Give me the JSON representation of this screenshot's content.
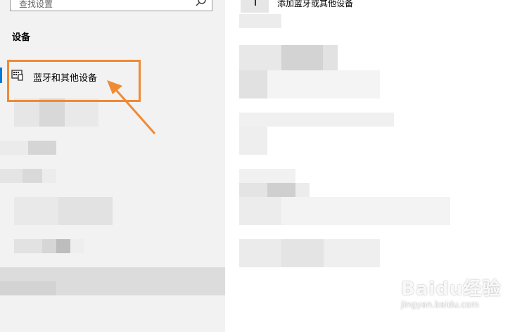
{
  "left_pane": {
    "search": {
      "placeholder": "查找设置"
    },
    "section_heading": "设备",
    "selected_item": {
      "label": "蓝牙和其他设备",
      "icon": "bluetooth-devices-icon"
    }
  },
  "right_pane": {
    "add_device_label": "添加蓝牙或其他设备",
    "add_device_icon": "add-icon"
  },
  "annotation": {
    "highlight_color": "#f08a33",
    "accent_color": "#0078d7"
  },
  "watermark": {
    "brand": "Baidu经验",
    "url": "jingyan.baidu.com"
  }
}
